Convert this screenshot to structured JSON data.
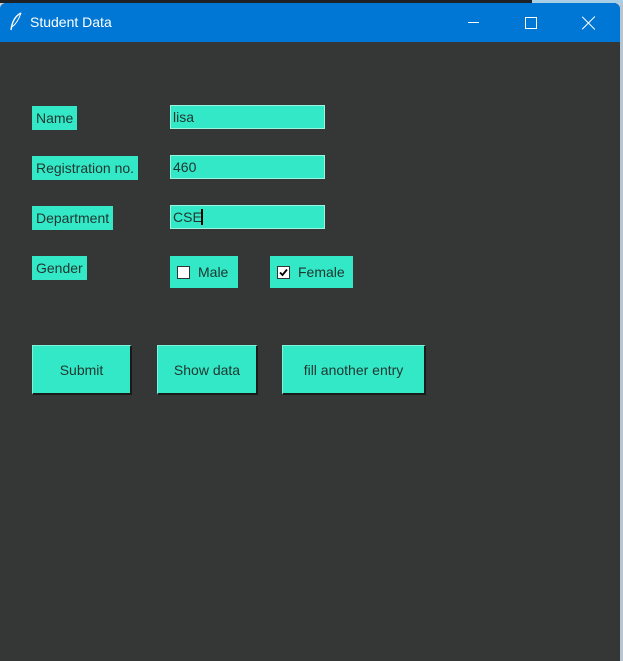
{
  "window": {
    "title": "Student Data",
    "icon": "feather-icon"
  },
  "form": {
    "name_label": "Name",
    "name_value": "lisa",
    "reg_label": "Registration no.",
    "reg_value": "460",
    "dept_label": "Department",
    "dept_value": "CSE",
    "gender_label": "Gender",
    "gender_options": [
      {
        "label": "Male",
        "checked": false
      },
      {
        "label": "Female",
        "checked": true
      }
    ]
  },
  "buttons": {
    "submit": "Submit",
    "show": "Show data",
    "another": "fill another entry"
  },
  "colors": {
    "background": "#353737",
    "accent": "#33e8c6",
    "titlebar": "#0077d4"
  }
}
